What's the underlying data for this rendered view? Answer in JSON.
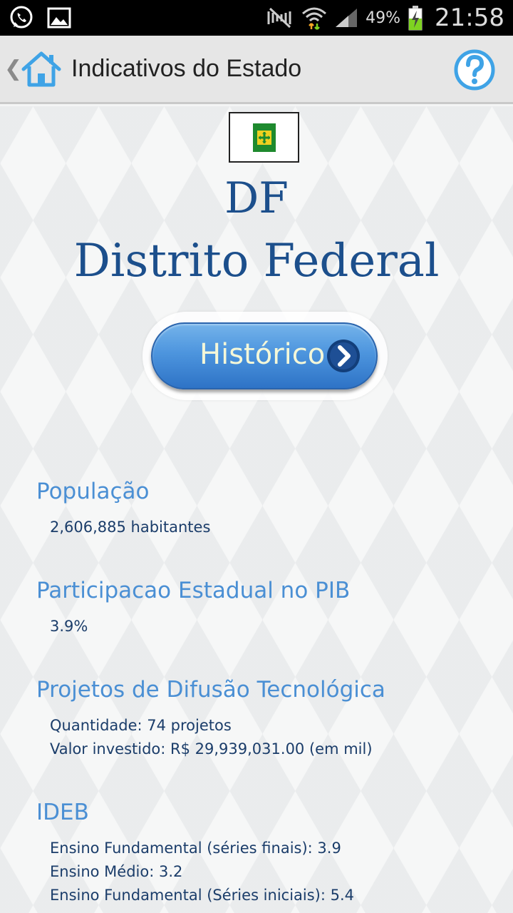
{
  "status_bar": {
    "battery_percent": "49%",
    "time": "21:58",
    "icons": [
      "whatsapp-icon",
      "image-icon",
      "mute-icon",
      "wifi-icon",
      "signal-icon",
      "battery-charging-icon"
    ]
  },
  "action_bar": {
    "title": "Indicativos do Estado",
    "back_icon": "chevron-left-icon",
    "home_icon": "home-icon",
    "help_icon": "help-icon"
  },
  "state": {
    "abbr": "DF",
    "name": "Distrito Federal",
    "flag_icon": "df-flag-icon"
  },
  "historico_button": {
    "label": "Histórico"
  },
  "sections": {
    "populacao": {
      "title": "População",
      "lines": [
        "2,606,885 habitantes"
      ]
    },
    "pib": {
      "title": "Participacao Estadual no PIB",
      "lines": [
        "3.9%"
      ]
    },
    "projetos": {
      "title": "Projetos de Difusão Tecnológica",
      "lines": [
        "Quantidade: 74 projetos",
        "Valor investido: R$ 29,939,031.00 (em mil)"
      ]
    },
    "ideb": {
      "title": "IDEB",
      "lines": [
        "Ensino Fundamental (séries finais): 3.9",
        "Ensino Médio: 3.2",
        "Ensino Fundamental (Séries iniciais): 5.4"
      ]
    }
  },
  "colors": {
    "accent_blue": "#4a8fd4",
    "title_navy": "#1c4f8c",
    "button_blue": "#4d95de"
  }
}
